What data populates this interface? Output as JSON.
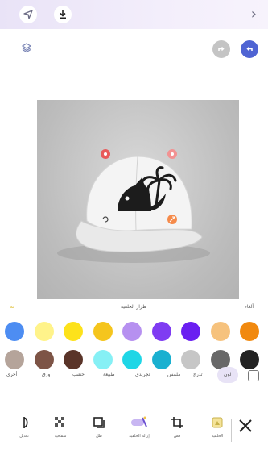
{
  "top_bar": {
    "forward_icon": "chevron-right-icon"
  },
  "panel": {
    "left_label": "ألغاء",
    "title": "طراز الخلفية",
    "right_label": "تم"
  },
  "swatches_row1": [
    "#4d8df2",
    "#fff38a",
    "#fde21b",
    "#f5c51d",
    "#b690f0",
    "#7f3cf2",
    "#6a1ff1",
    "#f6c27d",
    "#f1890f"
  ],
  "swatches_row2": [
    "#b5a49a",
    "#7d5446",
    "#5a3429",
    "#86f0f5",
    "#1fd6e6",
    "#1ab0d0",
    "#c6c6c6",
    "#686868",
    "#232323"
  ],
  "categories": [
    "لون",
    "تدرج",
    "ملمس",
    "تجريدي",
    "طبيعة",
    "خشب",
    "ورق",
    "أخرى"
  ],
  "tools": [
    {
      "label": "الخلفية"
    },
    {
      "label": "قص"
    },
    {
      "label": "إزالة الخلفية"
    },
    {
      "label": "ظل"
    },
    {
      "label": "شفافية"
    },
    {
      "label": "تعديل"
    }
  ]
}
